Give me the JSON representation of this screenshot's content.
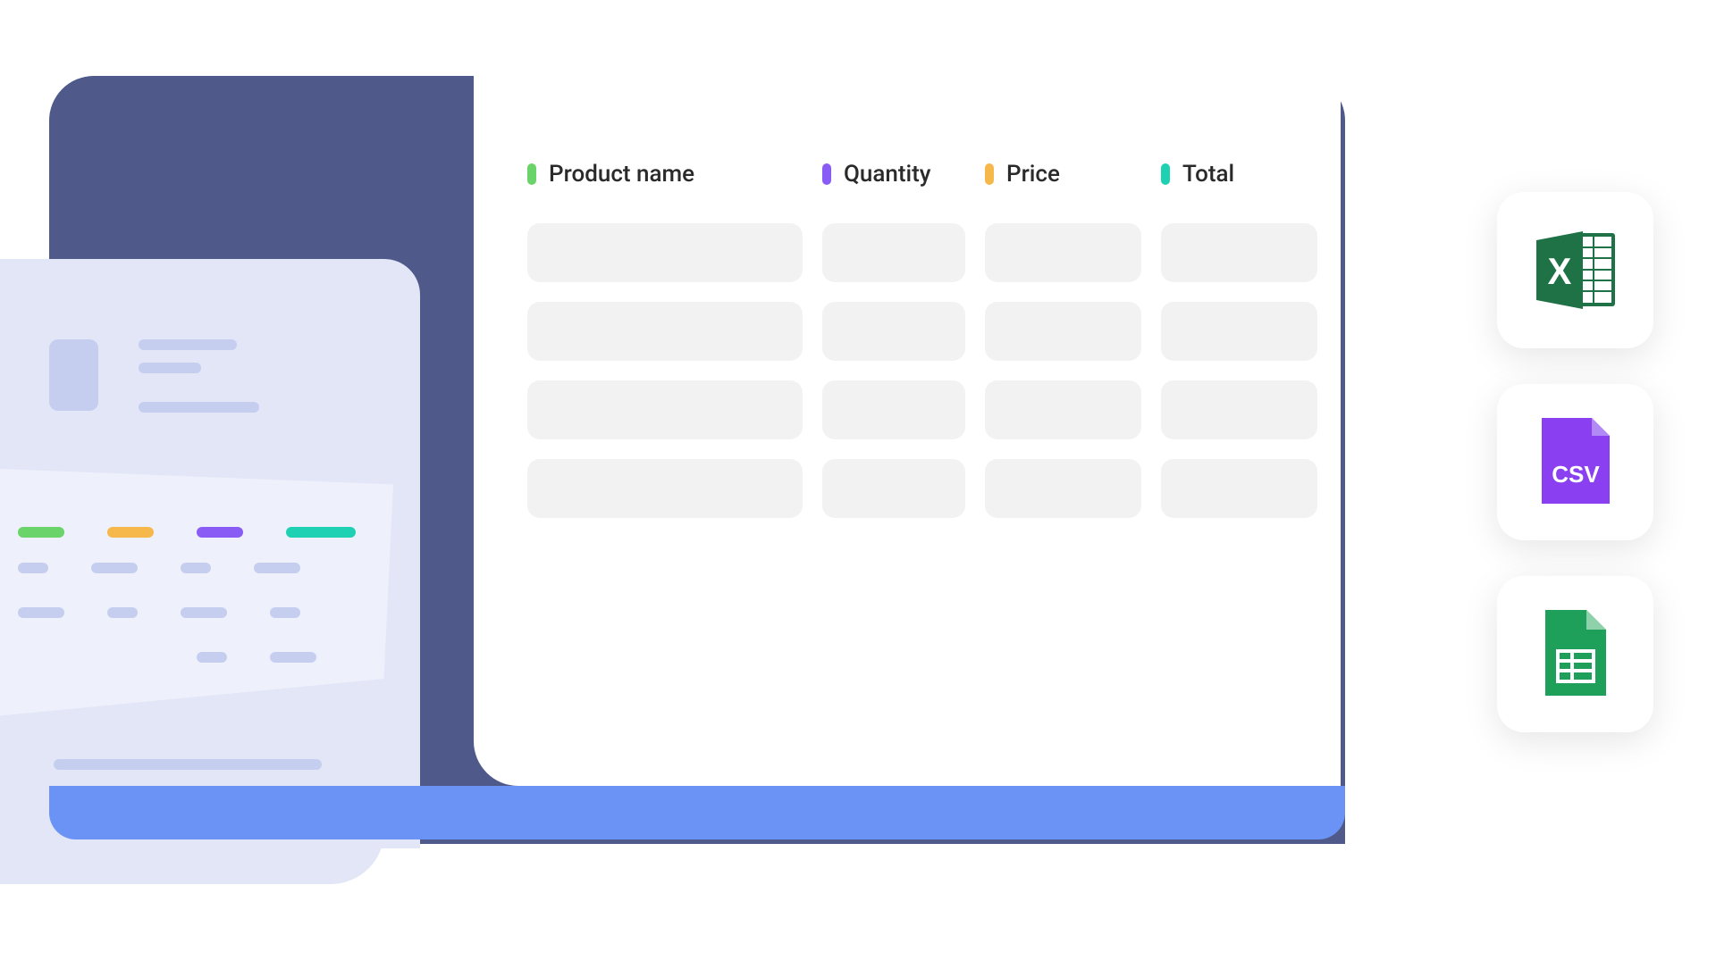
{
  "table": {
    "columns": [
      {
        "label": "Product name",
        "color": "#6ad36a"
      },
      {
        "label": "Quantity",
        "color": "#8a5cf6"
      },
      {
        "label": "Price",
        "color": "#f7b84b"
      },
      {
        "label": "Total",
        "color": "#1fd1b3"
      }
    ],
    "row_count": 4
  },
  "exports": {
    "excel": {
      "name": "excel-icon"
    },
    "csv": {
      "name": "csv-icon",
      "text": "CSV"
    },
    "sheets": {
      "name": "google-sheets-icon"
    }
  },
  "colors": {
    "device": "#4f5a8b",
    "device_base": "#6a93f5",
    "paper_light": "#eef1fb",
    "paper_dark": "#e2e6f7",
    "placeholder": "#c6cef0",
    "cell": "#f2f2f2"
  }
}
